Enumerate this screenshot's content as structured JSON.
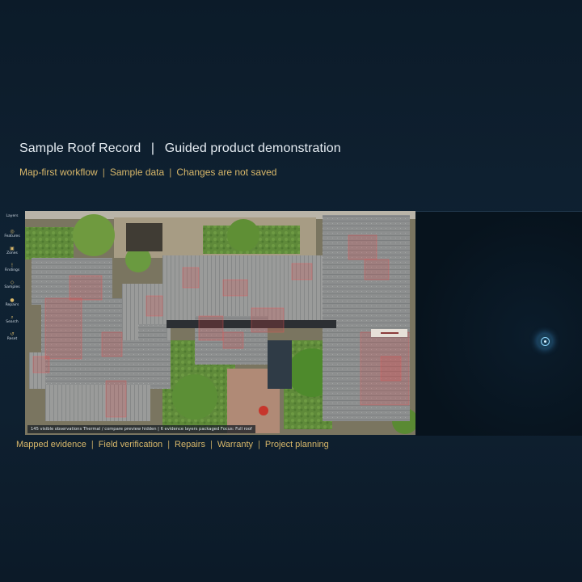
{
  "header": {
    "title_left": "Sample Roof Record",
    "title_right": "Guided product demonstration",
    "title_separator": "|",
    "subtitle_items": [
      "Map-first workflow",
      "Sample data",
      "Changes are not saved"
    ]
  },
  "toolbar": {
    "items": [
      {
        "label": "Layers",
        "icon": "layers-icon",
        "glyph": ""
      },
      {
        "label": "Features",
        "icon": "features-icon",
        "glyph": "◎"
      },
      {
        "label": "Zones",
        "icon": "zones-icon",
        "glyph": "▣"
      },
      {
        "label": "Findings",
        "icon": "findings-icon",
        "glyph": "!"
      },
      {
        "label": "Samples",
        "icon": "samples-icon",
        "glyph": "◇"
      },
      {
        "label": "Repairs",
        "icon": "repairs-icon",
        "glyph": "●"
      },
      {
        "label": "Search",
        "icon": "search-icon",
        "glyph": "⌕"
      },
      {
        "label": "Reset",
        "icon": "reset-icon",
        "glyph": "↺"
      }
    ]
  },
  "map": {
    "status_text": "145 visible observations  Thermal / compare preview hidden | 6 evidence layers packaged  Focus: Full roof"
  },
  "footer": {
    "items": [
      "Mapped evidence",
      "Field verification",
      "Repairs",
      "Warranty",
      "Project planning"
    ]
  },
  "colors": {
    "accent_gold": "#d9b86a",
    "locator_blue": "#5ab8ff",
    "background": "#0f1f2f"
  }
}
